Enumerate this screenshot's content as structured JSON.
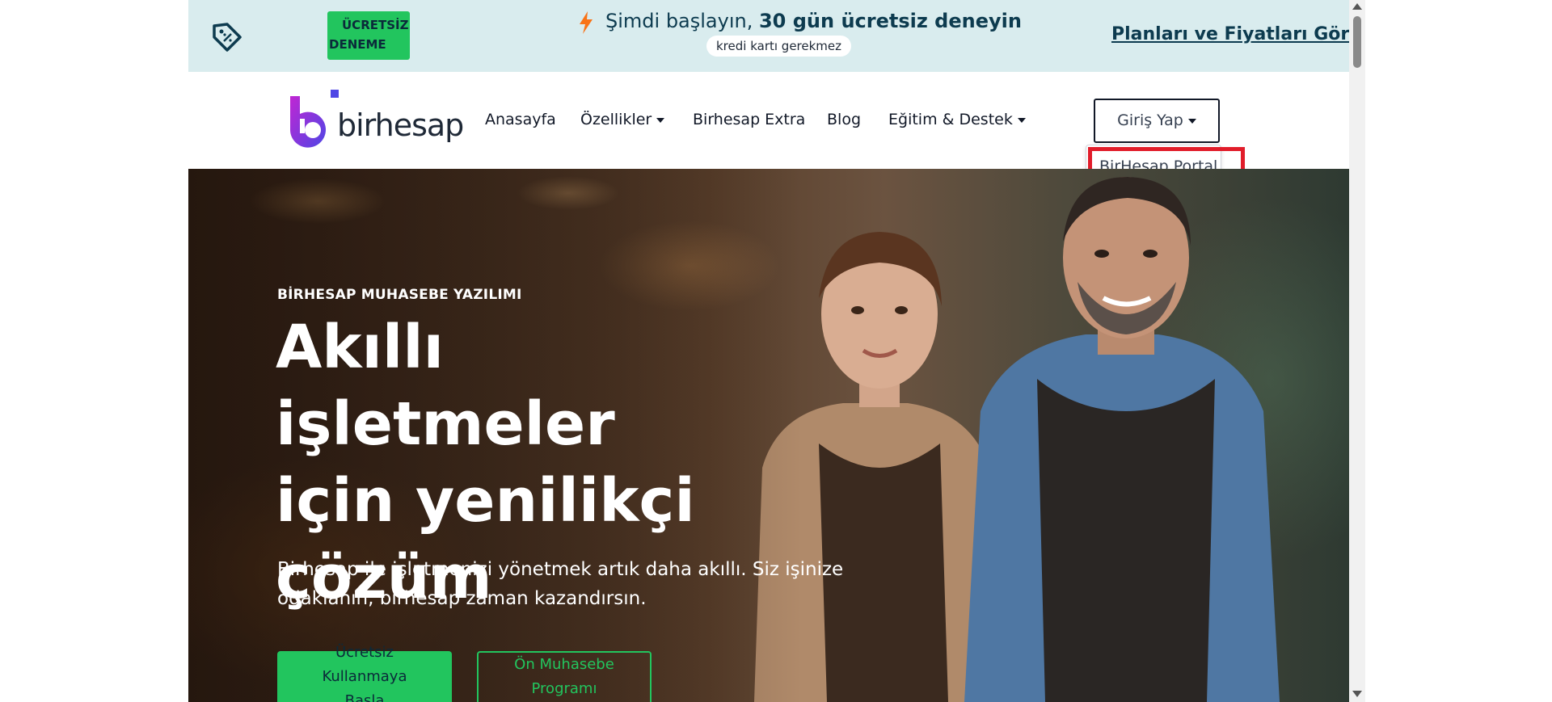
{
  "promo": {
    "badge_line1": "ÜCRETSİZ",
    "badge_line2": "DENEME",
    "headline_normal": "Şimdi başlayın, ",
    "headline_bold": "30 gün ücretsiz deneyin",
    "subtext": "kredi kartı gerekmez",
    "plans_link": "Planları ve Fiyatları Görün",
    "colors": {
      "background": "#d9ecee",
      "badge": "#22c55e",
      "text": "#0d3b4f"
    },
    "icons": [
      "price-tag-icon",
      "lightning-bolt-icon"
    ]
  },
  "nav": {
    "logo_text": "birhesap",
    "items": [
      {
        "label": "Anasayfa"
      },
      {
        "label": "Özellikler"
      },
      {
        "label": "Birhesap Extra"
      },
      {
        "label": "Blog"
      },
      {
        "label": "Eğitim & Destek"
      }
    ],
    "login_label": "Giriş Yap",
    "dropdown_items": [
      {
        "label": "BirHesap Portal"
      }
    ],
    "colors": {
      "highlight": "#e11d2a",
      "logo_accent": "#6d28d9"
    }
  },
  "hero": {
    "eyebrow": "BİRHESAP MUHASEBE YAZILIMI",
    "title_line1": "Akıllı işletmeler",
    "title_line2": "için yenilikçi",
    "title_line3": "çözüm",
    "lead": "Birhesap ile işletmenizi yönetmek artık daha akıllı. Siz işinize odaklanın, birhesap zaman kazandırsın.",
    "primary_button": [
      "Ücretsiz",
      "Kullanmaya",
      "Başla"
    ],
    "secondary_button": [
      "Ön Muhasebe",
      "Programı"
    ],
    "colors": {
      "accent": "#22c55e"
    }
  }
}
